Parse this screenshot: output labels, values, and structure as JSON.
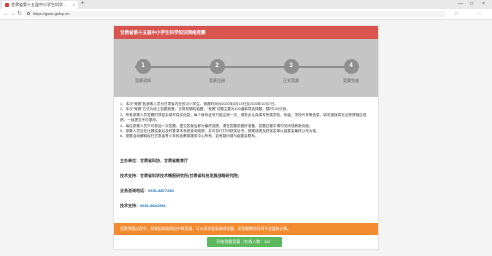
{
  "browser": {
    "tab_title": "甘肃省第十五届中小学生科学...",
    "tab_close": "×",
    "new_tab": "+",
    "url": "https://gsdc.gsfcp.cn",
    "window_controls": [
      "—",
      "□",
      "×"
    ],
    "nav": {
      "back": "←",
      "forward": "→",
      "refresh": "↻"
    },
    "right_icons": [
      "☆",
      "⋯"
    ]
  },
  "card": {
    "title": "甘肃省第十五届中小学生科学知识网络竞赛",
    "steps": [
      {
        "num": "1",
        "label": "竞赛须知"
      },
      {
        "num": "2",
        "label": "竞赛注册"
      },
      {
        "num": "3",
        "label": "正式竞赛"
      },
      {
        "num": "4",
        "label": "竞赛完成"
      }
    ],
    "notes": [
      "1、本次“竞赛”各参赛人员为甘肃省内在校中小学生，竞赛时间为2020年5月15日至2020年10月7日。",
      "2、本次“竞赛”方式为线上答题竞赛，计算机随机抽题，“竞赛”试题主要为100道单项选择题，限时100分钟。",
      "3、所有参赛人员答题时须如实填写真实信息，每个身份证号只能注册一次，请务必认真填写所属学校、年级、学校代号等信息，填写错误将无法获得相应成绩，一经提交不可更改。",
      "4、每位参赛人员只可参加一次答题，提交答案后即为最终成绩，请在答题前做好准备，答题过程中请勿关闭或刷新页面。",
      "5、参赛人员应在比赛结束后及时登录本系统查询成绩，并可自行打印获奖证书，竞赛成绩及获奖名单以组委会最终公布为准。",
      "6、竞赛活动解释权归甘肃省青少年科技教育服务中心所有，如有疑问请与组委会联系。"
    ],
    "organizer_label": "主办单位：",
    "organizer": "甘肃省科协、甘肃省教育厅",
    "support_label": "技术支持：",
    "support": "甘肃省科学技术情报研究所(甘肃省科技发展战略研究院)",
    "contact_label": "业务咨询电话：",
    "contact_phone": "0931-8877280",
    "tech_label": "技术支持：",
    "tech_phone": "0931-8641981",
    "warning": "竞赛答题过程中，如果因网络原因中断竞赛，可以再次登录继续答题，但答题剩余时间不会重新计算。",
    "start_button": "开始答题竞赛（在线人数：48）"
  },
  "colors": {
    "header": "#d9534f",
    "steps_bg": "#c5c5c5",
    "warning": "#f28a30",
    "start_button": "#5cb85c",
    "link": "#1a6fb5"
  }
}
